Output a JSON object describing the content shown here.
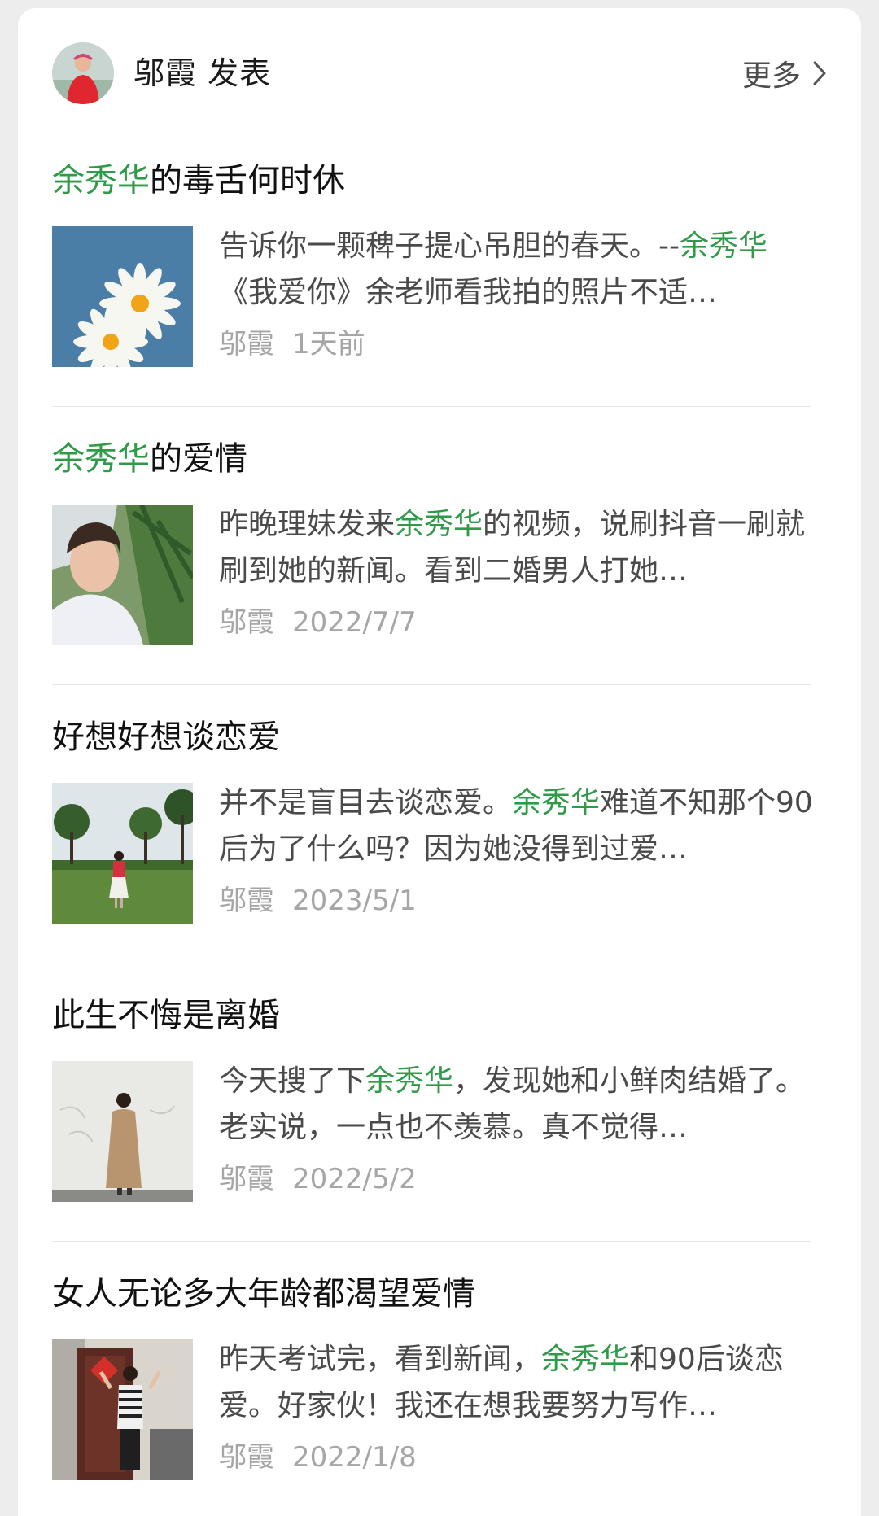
{
  "header": {
    "author_label": "邬霞 发表",
    "more_label": "更多"
  },
  "posts": [
    {
      "title_hl": "余秀华",
      "title_rest": "的毒舌何时休",
      "excerpt_pre": "告诉你一颗稗子提心吊胆的春天。--",
      "excerpt_hl": "余秀华",
      "excerpt_post": "《我爱你》余老师看我拍的照片不适…",
      "author": "邬霞",
      "time": "1天前"
    },
    {
      "title_hl": "余秀华",
      "title_rest": "的爱情",
      "excerpt_pre": "昨晚理妹发来",
      "excerpt_hl": "余秀华",
      "excerpt_post": "的视频，说刷抖音一刷就刷到她的新闻。看到二婚男人打她…",
      "author": "邬霞",
      "time": "2022/7/7"
    },
    {
      "title_hl": "",
      "title_rest": "好想好想谈恋爱",
      "excerpt_pre": "并不是盲目去谈恋爱。",
      "excerpt_hl": "余秀华",
      "excerpt_post": "难道不知那个90后为了什么吗？因为她没得到过爱…",
      "author": "邬霞",
      "time": "2023/5/1"
    },
    {
      "title_hl": "",
      "title_rest": "此生不悔是离婚",
      "excerpt_pre": "今天搜了下",
      "excerpt_hl": "余秀华",
      "excerpt_post": "，发现她和小鲜肉结婚了。老实说，一点也不羡慕。真不觉得…",
      "author": "邬霞",
      "time": "2022/5/2"
    },
    {
      "title_hl": "",
      "title_rest": "女人无论多大年龄都渴望爱情",
      "excerpt_pre": "昨天考试完，看到新闻，",
      "excerpt_hl": "余秀华",
      "excerpt_post": "和90后谈恋爱。好家伙！我还在想我要努力写作…",
      "author": "邬霞",
      "time": "2022/1/8"
    }
  ]
}
